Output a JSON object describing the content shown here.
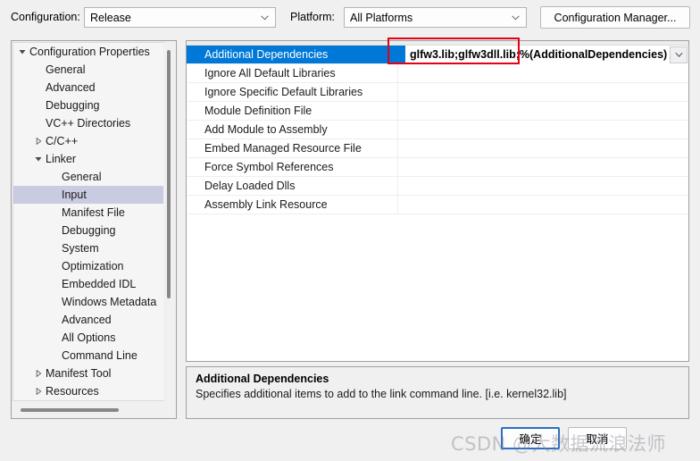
{
  "toolbar": {
    "configuration_label": "Configuration:",
    "configuration_value": "Release",
    "platform_label": "Platform:",
    "platform_value": "All Platforms",
    "configuration_manager_label": "Configuration Manager..."
  },
  "tree": {
    "items": [
      {
        "label": "Configuration Properties",
        "indent": 0,
        "expander": "expanded",
        "selected": false
      },
      {
        "label": "General",
        "indent": 1,
        "expander": "none",
        "selected": false
      },
      {
        "label": "Advanced",
        "indent": 1,
        "expander": "none",
        "selected": false
      },
      {
        "label": "Debugging",
        "indent": 1,
        "expander": "none",
        "selected": false
      },
      {
        "label": "VC++ Directories",
        "indent": 1,
        "expander": "none",
        "selected": false
      },
      {
        "label": "C/C++",
        "indent": 1,
        "expander": "collapsed",
        "selected": false
      },
      {
        "label": "Linker",
        "indent": 1,
        "expander": "expanded",
        "selected": false
      },
      {
        "label": "General",
        "indent": 2,
        "expander": "none",
        "selected": false
      },
      {
        "label": "Input",
        "indent": 2,
        "expander": "none",
        "selected": true
      },
      {
        "label": "Manifest File",
        "indent": 2,
        "expander": "none",
        "selected": false
      },
      {
        "label": "Debugging",
        "indent": 2,
        "expander": "none",
        "selected": false
      },
      {
        "label": "System",
        "indent": 2,
        "expander": "none",
        "selected": false
      },
      {
        "label": "Optimization",
        "indent": 2,
        "expander": "none",
        "selected": false
      },
      {
        "label": "Embedded IDL",
        "indent": 2,
        "expander": "none",
        "selected": false
      },
      {
        "label": "Windows Metadata",
        "indent": 2,
        "expander": "none",
        "selected": false
      },
      {
        "label": "Advanced",
        "indent": 2,
        "expander": "none",
        "selected": false
      },
      {
        "label": "All Options",
        "indent": 2,
        "expander": "none",
        "selected": false
      },
      {
        "label": "Command Line",
        "indent": 2,
        "expander": "none",
        "selected": false
      },
      {
        "label": "Manifest Tool",
        "indent": 1,
        "expander": "collapsed",
        "selected": false
      },
      {
        "label": "Resources",
        "indent": 1,
        "expander": "collapsed",
        "selected": false
      }
    ]
  },
  "grid": {
    "rows": [
      {
        "name": "Additional Dependencies",
        "value": "glfw3.lib;glfw3dll.lib;%(AdditionalDependencies)",
        "selected": true
      },
      {
        "name": "Ignore All Default Libraries",
        "value": "",
        "selected": false
      },
      {
        "name": "Ignore Specific Default Libraries",
        "value": "",
        "selected": false
      },
      {
        "name": "Module Definition File",
        "value": "",
        "selected": false
      },
      {
        "name": "Add Module to Assembly",
        "value": "",
        "selected": false
      },
      {
        "name": "Embed Managed Resource File",
        "value": "",
        "selected": false
      },
      {
        "name": "Force Symbol References",
        "value": "",
        "selected": false
      },
      {
        "name": "Delay Loaded Dlls",
        "value": "",
        "selected": false
      },
      {
        "name": "Assembly Link Resource",
        "value": "",
        "selected": false
      }
    ],
    "editor_value": "glfw3.lib;glfw3dll.lib;%(AdditionalDependencies)"
  },
  "description": {
    "title": "Additional Dependencies",
    "body": "Specifies additional items to add to the link command line. [i.e. kernel32.lib]"
  },
  "footer": {
    "ok_label": "确定",
    "cancel_label": "取消"
  },
  "watermark": {
    "text": "CSDN @大数据流浪法师"
  },
  "colors": {
    "selection_blue": "#0078d7",
    "tree_selection": "#c9cbe0",
    "annotation_red": "#e60012",
    "focus_blue": "#2a6fc4"
  }
}
